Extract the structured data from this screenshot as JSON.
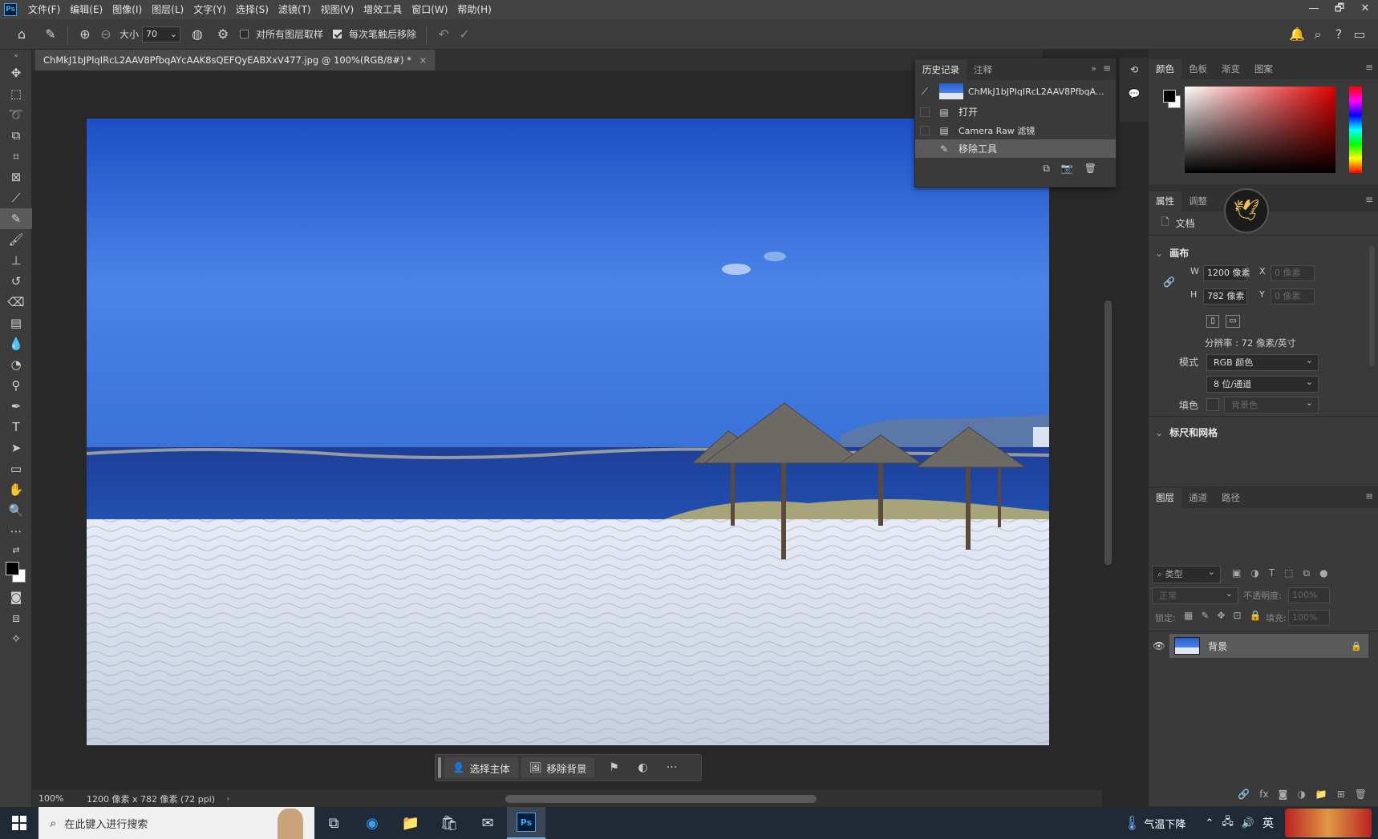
{
  "menu": {
    "app_icon": "Ps",
    "items": [
      "文件(F)",
      "编辑(E)",
      "图像(I)",
      "图层(L)",
      "文字(Y)",
      "选择(S)",
      "滤镜(T)",
      "视图(V)",
      "增效工具",
      "窗口(W)",
      "帮助(H)"
    ]
  },
  "window_controls": [
    "—",
    "🗗",
    "✕"
  ],
  "options": {
    "size_label": "大小",
    "size_value": "70",
    "sample_all_label": "对所有图层取样",
    "remove_after_label": "每次笔触后移除"
  },
  "document": {
    "tab_title": "ChMkJ1bJPlqIRcL2AAV8PfbqAYcAAK8sQEFQyEABXxV477.jpg @ 100%(RGB/8#) *",
    "tab_close": "×"
  },
  "context_bar": {
    "select_subject": "选择主体",
    "remove_background": "移除背景",
    "more": "···"
  },
  "status": {
    "zoom": "100%",
    "info": "1200 像素 x 782 像素 (72 ppi)",
    "arrow": "›"
  },
  "history": {
    "tabs": [
      "历史记录",
      "注释"
    ],
    "snapshot_name": "ChMkJ1bJPIqIRcL2AAV8PfbqA...",
    "steps": [
      "打开",
      "Camera Raw 滤镜",
      "移除工具"
    ]
  },
  "color_panel": {
    "tabs": [
      "颜色",
      "色板",
      "渐变",
      "图案"
    ]
  },
  "properties": {
    "tabs": [
      "属性",
      "调整"
    ],
    "doc_label": "文档",
    "canvas_section": "画布",
    "w_label": "W",
    "w_value": "1200 像素",
    "h_label": "H",
    "h_value": "782 像素",
    "x_label": "X",
    "x_value": "0 像素",
    "y_label": "Y",
    "y_value": "0 像素",
    "resolution": "分辨率 : 72 像素/英寸",
    "mode_label": "模式",
    "mode_value": "RGB 颜色",
    "depth_value": "8 位/通道",
    "fill_label": "填色",
    "fill_value": "背景色",
    "rulers_section": "标尺和网格"
  },
  "layers": {
    "tabs": [
      "图层",
      "通道",
      "路径"
    ],
    "filter_placeholder": "类型",
    "blend_mode": "正常",
    "opacity_label": "不透明度:",
    "opacity_value": "100%",
    "lock_label": "锁定:",
    "fill_label": "填充:",
    "fill_value": "100%",
    "layer_name": "背景"
  },
  "taskbar": {
    "search_placeholder": "在此键入进行搜索",
    "weather": "气温下降",
    "ime": "英",
    "ps_label": "Ps"
  },
  "colors": {
    "accent": "#31a8ff",
    "panel_bg": "#3a3a3a",
    "selected_row": "#5a5a5a"
  }
}
